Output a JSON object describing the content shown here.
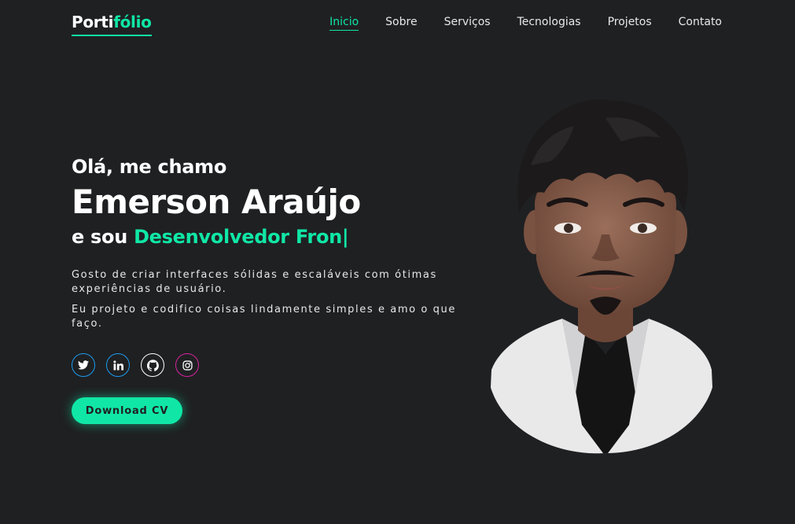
{
  "logo": {
    "part1": "Porti",
    "part2": "fólio"
  },
  "nav": {
    "items": [
      {
        "label": "Inicio"
      },
      {
        "label": "Sobre"
      },
      {
        "label": "Serviços"
      },
      {
        "label": "Tecnologias"
      },
      {
        "label": "Projetos"
      },
      {
        "label": "Contato"
      }
    ]
  },
  "hero": {
    "greeting": "Olá, me chamo",
    "name": "Emerson Araújo",
    "role_prefix": "e sou",
    "role_typed": "Desenvolvedor Fron",
    "cursor": "|",
    "desc1": "Gosto de criar interfaces sólidas e escaláveis com ótimas experiências de usuário.",
    "desc2": "Eu projeto e codifico coisas lindamente simples e amo o que faço."
  },
  "social": {
    "icons": [
      "twitter-icon",
      "linkedin-icon",
      "github-icon",
      "instagram-icon"
    ]
  },
  "cta": {
    "download_label": "Download CV"
  },
  "colors": {
    "accent": "#10e7a6",
    "background": "#1f2022",
    "twitter": "#1d9bf0",
    "instagram": "#d6249f"
  }
}
